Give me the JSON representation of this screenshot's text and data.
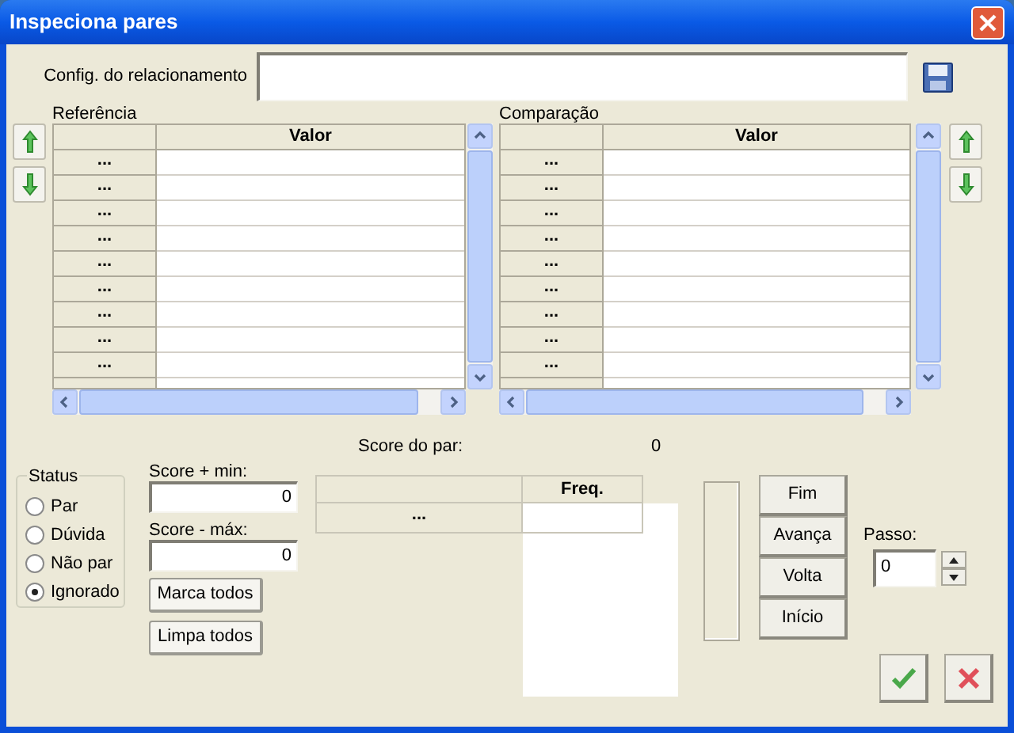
{
  "window": {
    "title": "Inspeciona pares"
  },
  "config": {
    "label": "Config. do relacionamento"
  },
  "reference": {
    "label": "Referência",
    "column": "Valor",
    "rows": [
      "...",
      "...",
      "...",
      "...",
      "...",
      "...",
      "...",
      "...",
      "..."
    ]
  },
  "comparison": {
    "label": "Comparação",
    "column": "Valor",
    "rows": [
      "...",
      "...",
      "...",
      "...",
      "...",
      "...",
      "...",
      "...",
      "..."
    ]
  },
  "score": {
    "label": "Score do par:",
    "value": "0"
  },
  "status": {
    "title": "Status",
    "options": [
      {
        "label": "Par",
        "selected": false
      },
      {
        "label": "Dúvida",
        "selected": false
      },
      {
        "label": "Não par",
        "selected": false
      },
      {
        "label": "Ignorado",
        "selected": true
      }
    ]
  },
  "score_min": {
    "label": "Score + min:",
    "value": "0"
  },
  "score_max": {
    "label": "Score - máx:",
    "value": "0"
  },
  "mark_buttons": [
    "Marca todos",
    "Limpa todos"
  ],
  "freq_table": {
    "header": "Freq.",
    "rows": [
      "..."
    ]
  },
  "nav_buttons": [
    "Fim",
    "Avança",
    "Volta",
    "Início"
  ],
  "step": {
    "label": "Passo:",
    "value": "0"
  }
}
